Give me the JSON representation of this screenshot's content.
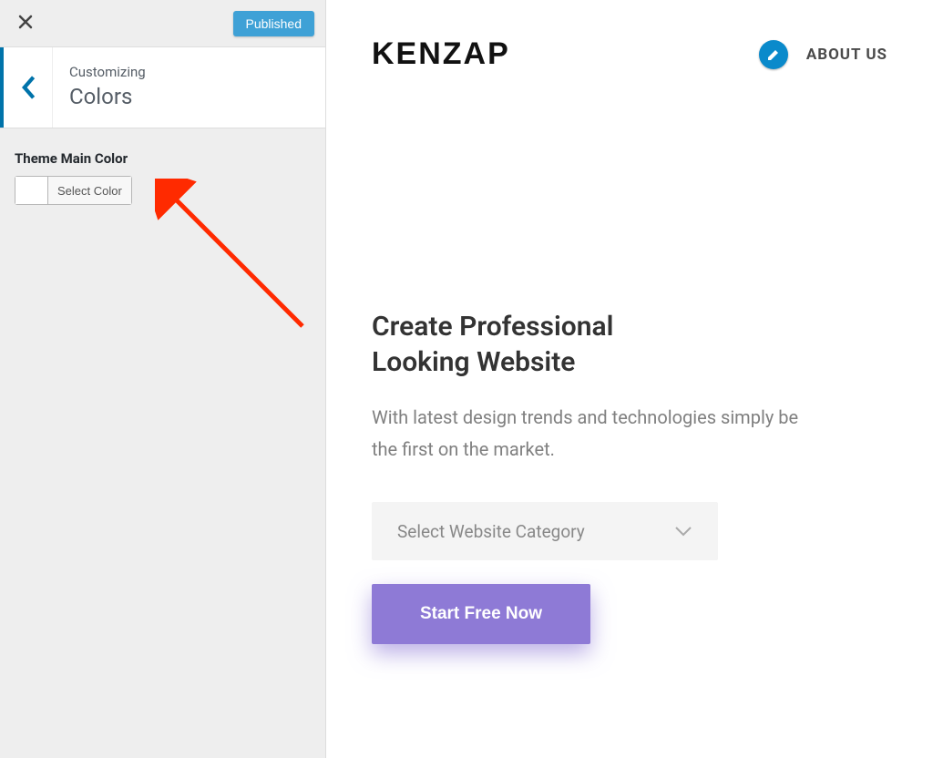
{
  "sidebar": {
    "published_label": "Published",
    "customizing_label": "Customizing",
    "section_title": "Colors",
    "theme_color_label": "Theme Main Color",
    "select_color_label": "Select Color",
    "current_color": "#ffffff"
  },
  "preview": {
    "brand": "KENZAP",
    "nav": {
      "about": "ABOUT US"
    },
    "hero": {
      "title_line1": "Create Professional",
      "title_line2": "Looking Website",
      "subtitle": "With latest design trends and technologies simply be the first on the market.",
      "select_placeholder": "Select Website Category",
      "cta_label": "Start Free Now"
    }
  },
  "colors": {
    "accent_blue": "#0073aa",
    "cta_purple": "#8e7ad6"
  }
}
